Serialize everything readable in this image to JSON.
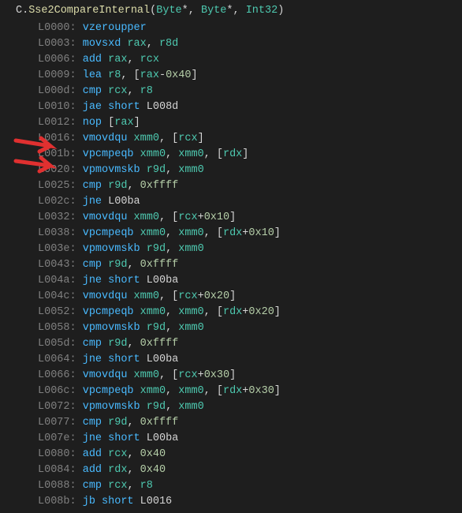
{
  "title": {
    "prefix": "C.",
    "method": "Sse2CompareInternal",
    "paren_open": "(",
    "p1": "Byte",
    "star1": "*",
    "p2": "Byte",
    "star2": "*",
    "p3": "Int32",
    "paren_close": ")"
  },
  "lines": [
    {
      "label": "L0000:",
      "mn": "vzeroupper",
      "ops": []
    },
    {
      "label": "L0003:",
      "mn": "movsxd",
      "ops": [
        {
          "t": "reg",
          "v": "rax"
        },
        {
          "t": "p",
          "v": ", "
        },
        {
          "t": "reg",
          "v": "r8d"
        }
      ]
    },
    {
      "label": "L0006:",
      "mn": "add",
      "ops": [
        {
          "t": "reg",
          "v": "rax"
        },
        {
          "t": "p",
          "v": ", "
        },
        {
          "t": "reg",
          "v": "rcx"
        }
      ]
    },
    {
      "label": "L0009:",
      "mn": "lea",
      "ops": [
        {
          "t": "reg",
          "v": "r8"
        },
        {
          "t": "p",
          "v": ", ["
        },
        {
          "t": "reg",
          "v": "rax"
        },
        {
          "t": "p",
          "v": "-"
        },
        {
          "t": "num",
          "v": "0x40"
        },
        {
          "t": "p",
          "v": "]"
        }
      ]
    },
    {
      "label": "L000d:",
      "mn": "cmp",
      "ops": [
        {
          "t": "reg",
          "v": "rcx"
        },
        {
          "t": "p",
          "v": ", "
        },
        {
          "t": "reg",
          "v": "r8"
        }
      ]
    },
    {
      "label": "L0010:",
      "mn": "jae",
      "ops": [
        {
          "t": "kw",
          "v": "short"
        },
        {
          "t": "p",
          "v": " "
        },
        {
          "t": "lbl",
          "v": "L008d"
        }
      ]
    },
    {
      "label": "L0012:",
      "mn": "nop",
      "ops": [
        {
          "t": "p",
          "v": "["
        },
        {
          "t": "reg",
          "v": "rax"
        },
        {
          "t": "p",
          "v": "]"
        }
      ]
    },
    {
      "label": "L0016:",
      "mn": "vmovdqu",
      "ops": [
        {
          "t": "reg",
          "v": "xmm0"
        },
        {
          "t": "p",
          "v": ", ["
        },
        {
          "t": "reg",
          "v": "rcx"
        },
        {
          "t": "p",
          "v": "]"
        }
      ]
    },
    {
      "label": "L001b:",
      "mn": "vpcmpeqb",
      "ops": [
        {
          "t": "reg",
          "v": "xmm0"
        },
        {
          "t": "p",
          "v": ", "
        },
        {
          "t": "reg",
          "v": "xmm0"
        },
        {
          "t": "p",
          "v": ", ["
        },
        {
          "t": "reg",
          "v": "rdx"
        },
        {
          "t": "p",
          "v": "]"
        }
      ]
    },
    {
      "label": "L0020:",
      "mn": "vpmovmskb",
      "ops": [
        {
          "t": "reg",
          "v": "r9d"
        },
        {
          "t": "p",
          "v": ", "
        },
        {
          "t": "reg",
          "v": "xmm0"
        }
      ]
    },
    {
      "label": "L0025:",
      "mn": "cmp",
      "ops": [
        {
          "t": "reg",
          "v": "r9d"
        },
        {
          "t": "p",
          "v": ", "
        },
        {
          "t": "num",
          "v": "0xffff"
        }
      ]
    },
    {
      "label": "L002c:",
      "mn": "jne",
      "ops": [
        {
          "t": "lbl",
          "v": "L00ba"
        }
      ]
    },
    {
      "label": "L0032:",
      "mn": "vmovdqu",
      "ops": [
        {
          "t": "reg",
          "v": "xmm0"
        },
        {
          "t": "p",
          "v": ", ["
        },
        {
          "t": "reg",
          "v": "rcx"
        },
        {
          "t": "p",
          "v": "+"
        },
        {
          "t": "num",
          "v": "0x10"
        },
        {
          "t": "p",
          "v": "]"
        }
      ]
    },
    {
      "label": "L0038:",
      "mn": "vpcmpeqb",
      "ops": [
        {
          "t": "reg",
          "v": "xmm0"
        },
        {
          "t": "p",
          "v": ", "
        },
        {
          "t": "reg",
          "v": "xmm0"
        },
        {
          "t": "p",
          "v": ", ["
        },
        {
          "t": "reg",
          "v": "rdx"
        },
        {
          "t": "p",
          "v": "+"
        },
        {
          "t": "num",
          "v": "0x10"
        },
        {
          "t": "p",
          "v": "]"
        }
      ]
    },
    {
      "label": "L003e:",
      "mn": "vpmovmskb",
      "ops": [
        {
          "t": "reg",
          "v": "r9d"
        },
        {
          "t": "p",
          "v": ", "
        },
        {
          "t": "reg",
          "v": "xmm0"
        }
      ]
    },
    {
      "label": "L0043:",
      "mn": "cmp",
      "ops": [
        {
          "t": "reg",
          "v": "r9d"
        },
        {
          "t": "p",
          "v": ", "
        },
        {
          "t": "num",
          "v": "0xffff"
        }
      ]
    },
    {
      "label": "L004a:",
      "mn": "jne",
      "ops": [
        {
          "t": "kw",
          "v": "short"
        },
        {
          "t": "p",
          "v": " "
        },
        {
          "t": "lbl",
          "v": "L00ba"
        }
      ]
    },
    {
      "label": "L004c:",
      "mn": "vmovdqu",
      "ops": [
        {
          "t": "reg",
          "v": "xmm0"
        },
        {
          "t": "p",
          "v": ", ["
        },
        {
          "t": "reg",
          "v": "rcx"
        },
        {
          "t": "p",
          "v": "+"
        },
        {
          "t": "num",
          "v": "0x20"
        },
        {
          "t": "p",
          "v": "]"
        }
      ]
    },
    {
      "label": "L0052:",
      "mn": "vpcmpeqb",
      "ops": [
        {
          "t": "reg",
          "v": "xmm0"
        },
        {
          "t": "p",
          "v": ", "
        },
        {
          "t": "reg",
          "v": "xmm0"
        },
        {
          "t": "p",
          "v": ", ["
        },
        {
          "t": "reg",
          "v": "rdx"
        },
        {
          "t": "p",
          "v": "+"
        },
        {
          "t": "num",
          "v": "0x20"
        },
        {
          "t": "p",
          "v": "]"
        }
      ]
    },
    {
      "label": "L0058:",
      "mn": "vpmovmskb",
      "ops": [
        {
          "t": "reg",
          "v": "r9d"
        },
        {
          "t": "p",
          "v": ", "
        },
        {
          "t": "reg",
          "v": "xmm0"
        }
      ]
    },
    {
      "label": "L005d:",
      "mn": "cmp",
      "ops": [
        {
          "t": "reg",
          "v": "r9d"
        },
        {
          "t": "p",
          "v": ", "
        },
        {
          "t": "num",
          "v": "0xffff"
        }
      ]
    },
    {
      "label": "L0064:",
      "mn": "jne",
      "ops": [
        {
          "t": "kw",
          "v": "short"
        },
        {
          "t": "p",
          "v": " "
        },
        {
          "t": "lbl",
          "v": "L00ba"
        }
      ]
    },
    {
      "label": "L0066:",
      "mn": "vmovdqu",
      "ops": [
        {
          "t": "reg",
          "v": "xmm0"
        },
        {
          "t": "p",
          "v": ", ["
        },
        {
          "t": "reg",
          "v": "rcx"
        },
        {
          "t": "p",
          "v": "+"
        },
        {
          "t": "num",
          "v": "0x30"
        },
        {
          "t": "p",
          "v": "]"
        }
      ]
    },
    {
      "label": "L006c:",
      "mn": "vpcmpeqb",
      "ops": [
        {
          "t": "reg",
          "v": "xmm0"
        },
        {
          "t": "p",
          "v": ", "
        },
        {
          "t": "reg",
          "v": "xmm0"
        },
        {
          "t": "p",
          "v": ", ["
        },
        {
          "t": "reg",
          "v": "rdx"
        },
        {
          "t": "p",
          "v": "+"
        },
        {
          "t": "num",
          "v": "0x30"
        },
        {
          "t": "p",
          "v": "]"
        }
      ]
    },
    {
      "label": "L0072:",
      "mn": "vpmovmskb",
      "ops": [
        {
          "t": "reg",
          "v": "r9d"
        },
        {
          "t": "p",
          "v": ", "
        },
        {
          "t": "reg",
          "v": "xmm0"
        }
      ]
    },
    {
      "label": "L0077:",
      "mn": "cmp",
      "ops": [
        {
          "t": "reg",
          "v": "r9d"
        },
        {
          "t": "p",
          "v": ", "
        },
        {
          "t": "num",
          "v": "0xffff"
        }
      ]
    },
    {
      "label": "L007e:",
      "mn": "jne",
      "ops": [
        {
          "t": "kw",
          "v": "short"
        },
        {
          "t": "p",
          "v": " "
        },
        {
          "t": "lbl",
          "v": "L00ba"
        }
      ]
    },
    {
      "label": "L0080:",
      "mn": "add",
      "ops": [
        {
          "t": "reg",
          "v": "rcx"
        },
        {
          "t": "p",
          "v": ", "
        },
        {
          "t": "num",
          "v": "0x40"
        }
      ]
    },
    {
      "label": "L0084:",
      "mn": "add",
      "ops": [
        {
          "t": "reg",
          "v": "rdx"
        },
        {
          "t": "p",
          "v": ", "
        },
        {
          "t": "num",
          "v": "0x40"
        }
      ]
    },
    {
      "label": "L0088:",
      "mn": "cmp",
      "ops": [
        {
          "t": "reg",
          "v": "rcx"
        },
        {
          "t": "p",
          "v": ", "
        },
        {
          "t": "reg",
          "v": "r8"
        }
      ]
    },
    {
      "label": "L008b:",
      "mn": "jb",
      "ops": [
        {
          "t": "kw",
          "v": "short"
        },
        {
          "t": "p",
          "v": " "
        },
        {
          "t": "lbl",
          "v": "L0016"
        }
      ]
    }
  ]
}
